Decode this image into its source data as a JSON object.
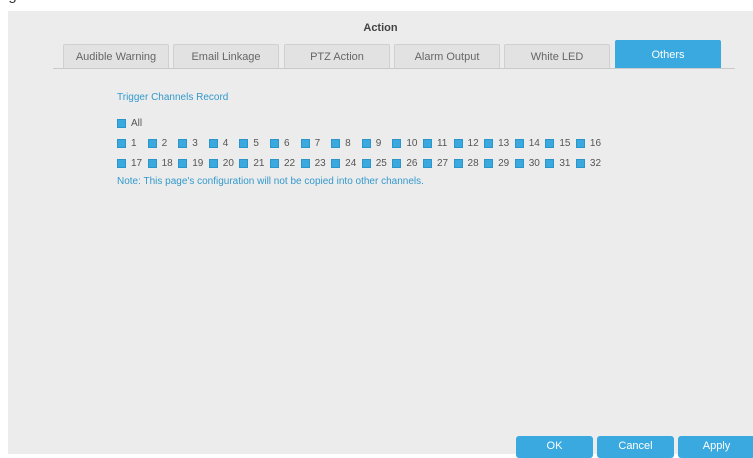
{
  "heading": "ng",
  "dialog": {
    "title": "Action"
  },
  "tabs": [
    {
      "label": "Audible Warning"
    },
    {
      "label": "Email Linkage"
    },
    {
      "label": "PTZ Action"
    },
    {
      "label": "Alarm Output"
    },
    {
      "label": "White LED"
    },
    {
      "label": "Others",
      "active": true
    }
  ],
  "section": {
    "title": "Trigger Channels Record",
    "all_label": "All",
    "channels_row1": [
      "1",
      "2",
      "3",
      "4",
      "5",
      "6",
      "7",
      "8",
      "9",
      "10",
      "11",
      "12",
      "13",
      "14",
      "15",
      "16"
    ],
    "channels_row2": [
      "17",
      "18",
      "19",
      "20",
      "21",
      "22",
      "23",
      "24",
      "25",
      "26",
      "27",
      "28",
      "29",
      "30",
      "31",
      "32"
    ],
    "note": "Note: This page's configuration will not be copied into other channels."
  },
  "buttons": {
    "ok": "OK",
    "cancel": "Cancel",
    "apply": "Apply"
  },
  "colors": {
    "accent": "#39a9e0",
    "panel": "#ececec",
    "text_blue": "#3399cc"
  }
}
